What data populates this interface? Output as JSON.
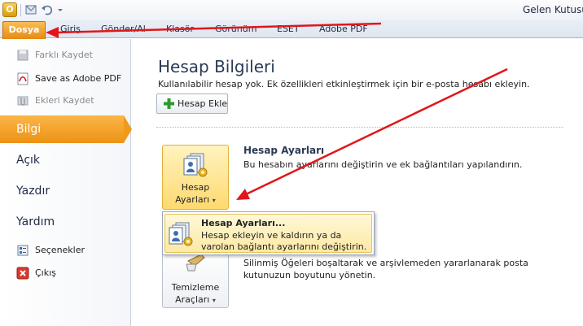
{
  "window": {
    "app_icon_letter": "O",
    "title": "Gelen Kutusu"
  },
  "ribbon": {
    "file_tab": "Dosya",
    "tabs": [
      "Giriş",
      "Gönder/Al",
      "Klasör",
      "Görünüm",
      "ESET",
      "Adobe PDF"
    ]
  },
  "backstage": {
    "commands_top": [
      {
        "label": "Farklı Kaydet",
        "icon": "save-as-icon",
        "enabled": false
      },
      {
        "label": "Save as Adobe PDF",
        "icon": "adobe-pdf-icon",
        "enabled": true
      },
      {
        "label": "Ekleri Kaydet",
        "icon": "save-attachments-icon",
        "enabled": false
      }
    ],
    "nav_items": [
      "Bilgi",
      "Açık",
      "Yazdır",
      "Yardım"
    ],
    "selected_nav": "Bilgi",
    "commands_bottom": [
      {
        "label": "Seçenekler",
        "icon": "options-icon"
      },
      {
        "label": "Çıkış",
        "icon": "exit-icon"
      }
    ]
  },
  "main": {
    "heading": "Hesap Bilgileri",
    "subtitle": "Kullanılabilir hesap yok. Ek özellikleri etkinleştirmek için bir e-posta hesabı ekleyin.",
    "add_account_button": "Hesap Ekle",
    "account_settings": {
      "button_line1": "Hesap",
      "button_line2": "Ayarları",
      "title": "Hesap Ayarları",
      "description": "Bu hesabın ayarlarını değiştirin ve ek bağlantıları yapılandırın."
    },
    "cleanup": {
      "button_line1": "Temizleme",
      "button_line2": "Araçları",
      "description": "Silinmiş Öğeleri boşaltarak ve arşivlemeden yararlanarak posta kutunuzun boyutunu yönetin."
    },
    "dropdown": {
      "item_title": "Hesap Ayarları...",
      "item_description": "Hesap ekleyin ve kaldırın ya da varolan bağlantı ayarlarını değiştirin."
    }
  },
  "colors": {
    "accent_orange": "#f09a1d",
    "annotation_red": "#e0161a"
  }
}
